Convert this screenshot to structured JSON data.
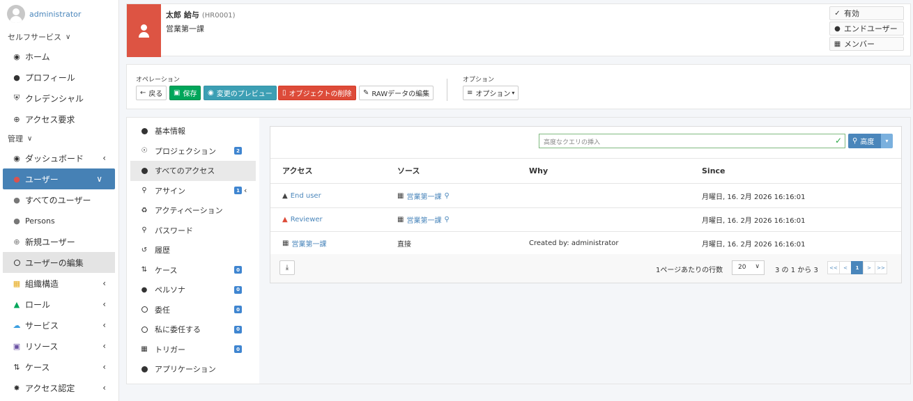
{
  "sidebar": {
    "username": "administrator",
    "sections": {
      "self_service": "セルフサービス",
      "admin": "管理"
    },
    "self_items": {
      "home": "ホーム",
      "profile": "プロフィール",
      "credentials": "クレデンシャル",
      "access_request": "アクセス要求"
    },
    "admin_items": {
      "dashboard": "ダッシュボード",
      "users": "ユーザー",
      "all_users": "すべてのユーザー",
      "persons": "Persons",
      "new_user": "新規ユーザー",
      "edit_user": "ユーザーの編集",
      "org": "組織構造",
      "role": "ロール",
      "service": "サービス",
      "resource": "リソース",
      "case": "ケース",
      "cert": "アクセス認定"
    }
  },
  "profile": {
    "name": "太郎 給与",
    "code": "(HR0001)",
    "department": "営業第一課",
    "badges": {
      "valid": "有効",
      "end_user": "エンドユーザー",
      "member": "メンバー"
    }
  },
  "toolbar": {
    "operations_label": "オペレーション",
    "options_label": "オプション",
    "back": "戻る",
    "save": "保存",
    "preview": "変更のプレビュー",
    "delete": "オブジェクトの削除",
    "raw": "RAWデータの編集",
    "options": "オプション"
  },
  "tabs": {
    "basic": "基本情報",
    "projection": "プロジェクション",
    "projection_count": "2",
    "all_access": "すべてのアクセス",
    "assign": "アサイン",
    "assign_count": "1",
    "activation": "アクティベーション",
    "password": "パスワード",
    "history": "履歴",
    "case": "ケース",
    "case_count": "0",
    "persona": "ペルソナ",
    "persona_count": "0",
    "delegation": "委任",
    "delegation_count": "0",
    "delegated_to_me": "私に委任する",
    "delegated_count": "0",
    "trigger": "トリガー",
    "trigger_count": "0",
    "application": "アプリケーション"
  },
  "access_panel": {
    "search_placeholder": "高度なクエリの挿入",
    "advanced": "高度",
    "columns": {
      "access": "アクセス",
      "source": "ソース",
      "why": "Why",
      "since": "Since"
    },
    "rows": [
      {
        "access": "End user",
        "source": "営業第一課",
        "why": "",
        "since": "月曜日, 16. 2月 2026 16:16:01"
      },
      {
        "access": "Reviewer",
        "source": "営業第一課",
        "why": "",
        "since": "月曜日, 16. 2月 2026 16:16:01"
      },
      {
        "access": "営業第一課",
        "source": "直接",
        "why": "Created by: administrator",
        "since": "月曜日, 16. 2月 2026 16:16:01"
      }
    ],
    "footer": {
      "rows_per_page": "1ページあたりの行数",
      "page_size": "20",
      "range": "3 の 1 から 3",
      "first": "<<",
      "prev": "<",
      "current": "1",
      "next": ">",
      "last": ">>"
    }
  }
}
